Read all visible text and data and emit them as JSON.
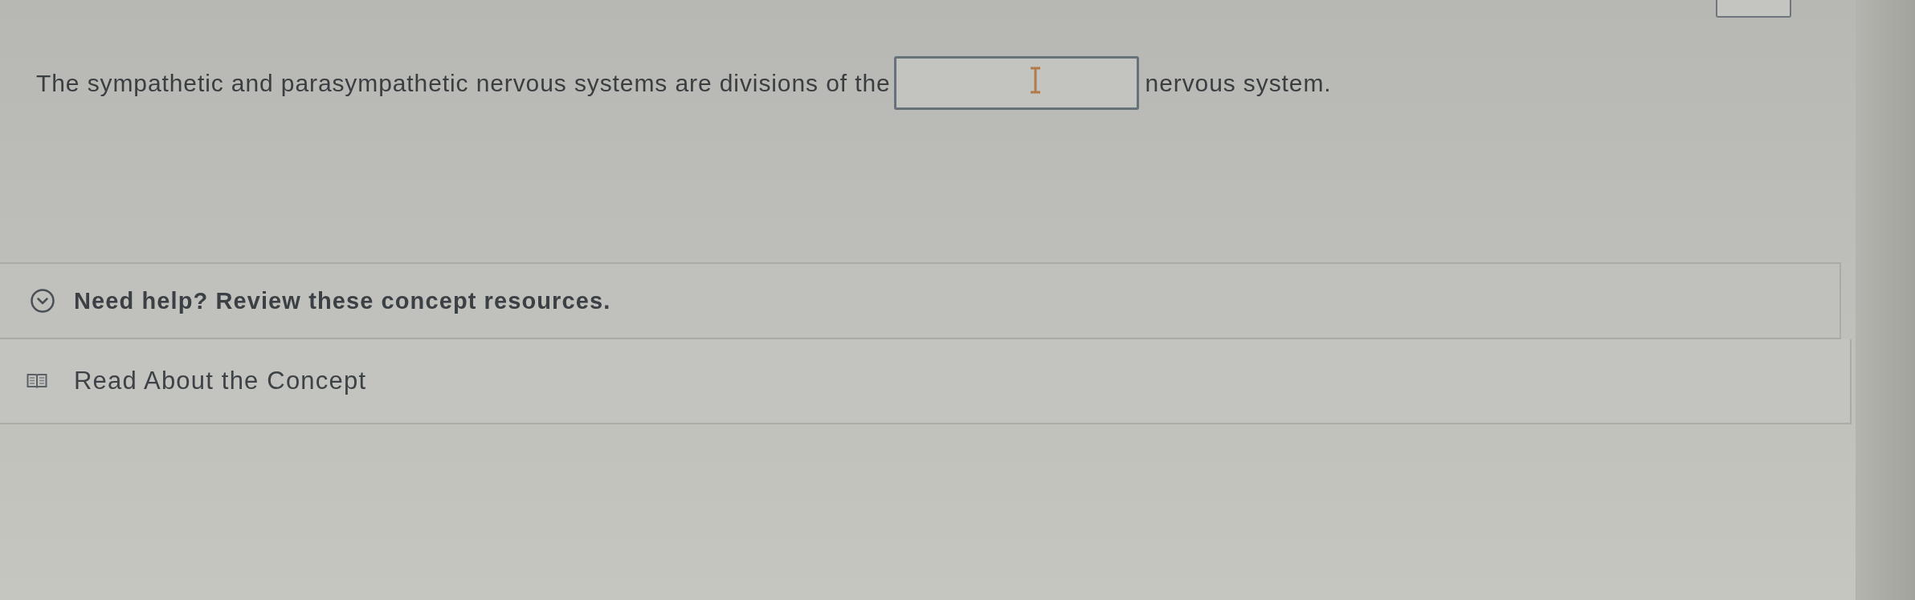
{
  "question": {
    "text_before": "The sympathetic and parasympathetic nervous systems are divisions of the",
    "text_after": "nervous system."
  },
  "help": {
    "title": "Need help? Review these concept resources.",
    "expanded": true,
    "resources": [
      {
        "kind": "reading",
        "label": "Read About the Concept"
      }
    ]
  }
}
